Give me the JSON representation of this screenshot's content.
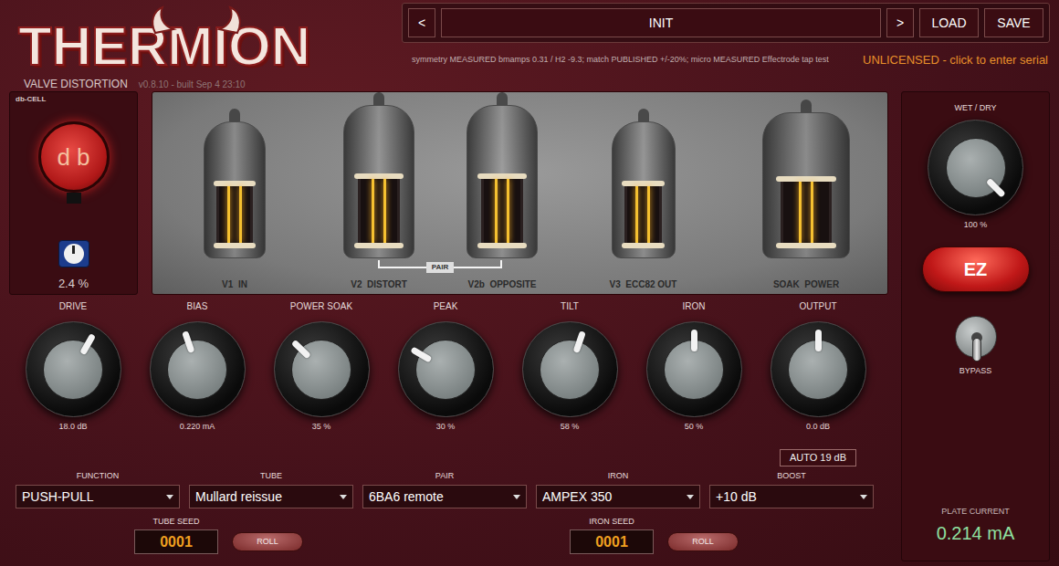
{
  "header": {
    "logo": "THERMION",
    "subtitle": "VALVE DISTORTION",
    "version": "v0.8.10 - built Sep 4 23:10"
  },
  "preset": {
    "prev": "<",
    "name": "INIT",
    "next": ">",
    "buttons": [
      "LOAD",
      "SAVE"
    ]
  },
  "info": "symmetry MEASURED bmamps 0.31 / H2 -9.3; match PUBLISHED +/-20%; micro MEASURED Effectrode tap test",
  "license": "UNLICENSED - click to enter serial",
  "db_cell": {
    "title": "db-CELL",
    "glyphs": "d b",
    "level": 0.5,
    "reading": "2.4 %"
  },
  "tubes": [
    {
      "label": "V1  IN"
    },
    {
      "label": "V2  DISTORT"
    },
    {
      "label": "V2b  OPPOSITE"
    },
    {
      "label": "V3  ECC82 OUT"
    },
    {
      "label": "SOAK  POWER"
    }
  ],
  "pair_label": "PAIR",
  "knobs": [
    {
      "label": "DRIVE",
      "level": 0.61,
      "reading": "18.0 dB"
    },
    {
      "label": "BIAS",
      "level": 0.43,
      "reading": "0.220 mA"
    },
    {
      "label": "POWER SOAK",
      "level": 0.33,
      "reading": "35 %"
    },
    {
      "label": "PEAK",
      "level": 0.28,
      "reading": "30 %"
    },
    {
      "label": "TILT",
      "level": 0.57,
      "reading": "58 %"
    },
    {
      "label": "IRON",
      "level": 0.5,
      "reading": "50 %"
    },
    {
      "label": "OUTPUT",
      "level": 0.5,
      "reading": "0.0 dB"
    }
  ],
  "auto": "AUTO 19 dB",
  "dropdowns": [
    {
      "label": "FUNCTION",
      "value": "PUSH-PULL"
    },
    {
      "label": "TUBE",
      "value": "Mullard reissue"
    },
    {
      "label": "PAIR",
      "value": "6BA6 remote"
    },
    {
      "label": "IRON",
      "value": "AMPEX 350"
    },
    {
      "label": "BOOST",
      "value": "+10 dB"
    }
  ],
  "seeds": [
    {
      "label": "TUBE SEED",
      "value": "0001",
      "button": "ROLL"
    },
    {
      "label": "IRON SEED",
      "value": "0001",
      "button": "ROLL"
    }
  ],
  "side": {
    "wet_dry": {
      "label": "WET / DRY",
      "level": 1.0,
      "reading": "100 %"
    },
    "ez": "EZ",
    "bypass": {
      "label": "BYPASS",
      "on": false
    },
    "plate_current": {
      "label": "PLATE CURRENT",
      "reading": "0.214 mA"
    }
  }
}
